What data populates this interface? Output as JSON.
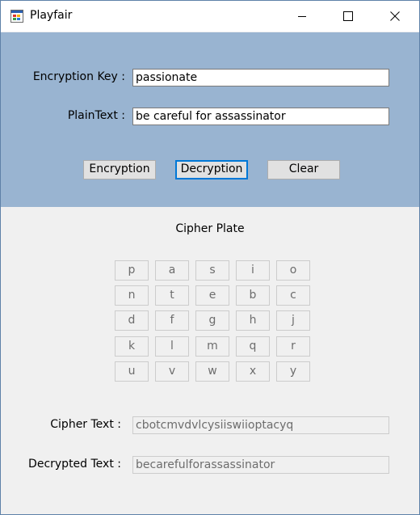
{
  "window": {
    "title": "Playfair",
    "icon": "windows-forms-app-icon",
    "controls": [
      "minimize-icon",
      "maximize-icon",
      "close-icon"
    ]
  },
  "form": {
    "key_label": "Encryption Key :",
    "key_value": "passionate",
    "plaintext_label": "PlainText :",
    "plaintext_value": "be careful for assassinator"
  },
  "buttons": {
    "encryption": "Encryption",
    "decryption": "Decryption",
    "clear": "Clear"
  },
  "plate": {
    "title": "Cipher Plate",
    "rows": [
      [
        "p",
        "a",
        "s",
        "i",
        "o"
      ],
      [
        "n",
        "t",
        "e",
        "b",
        "c"
      ],
      [
        "d",
        "f",
        "g",
        "h",
        "j"
      ],
      [
        "k",
        "l",
        "m",
        "q",
        "r"
      ],
      [
        "u",
        "v",
        "w",
        "x",
        "y"
      ]
    ]
  },
  "results": {
    "cipher_label": "Cipher Text :",
    "cipher_value": "cbotcmvdvlcysiiswiioptacyq",
    "decrypted_label": "Decrypted Text :",
    "decrypted_value": "becarefulforassassinator"
  },
  "colors": {
    "top_panel": "#99b4d1",
    "form_background": "#f0f0f0",
    "focus_border": "#0078d7"
  }
}
